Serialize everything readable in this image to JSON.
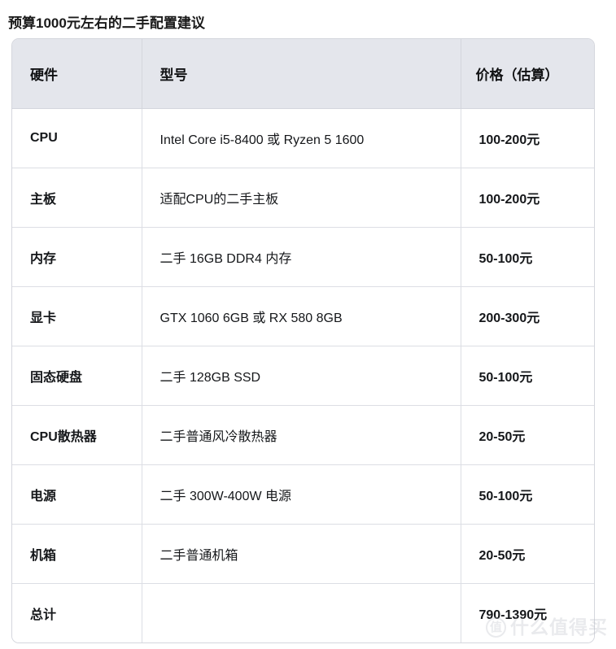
{
  "page": {
    "title": "预算1000元左右的二手配置建议",
    "background_color": "#ffffff",
    "text_color": "#1a1a1a"
  },
  "table": {
    "border_color": "#d4d6dd",
    "header_background": "#e4e6ec",
    "row_background": "#ffffff",
    "headers": {
      "hardware": "硬件",
      "model": "型号",
      "price": "价格（估算）"
    },
    "rows": [
      {
        "hardware": "CPU",
        "model": "Intel Core i5-8400 或 Ryzen 5 1600",
        "price": "100-200元"
      },
      {
        "hardware": "主板",
        "model": "适配CPU的二手主板",
        "price": "100-200元"
      },
      {
        "hardware": "内存",
        "model": "二手 16GB DDR4 内存",
        "price": "50-100元"
      },
      {
        "hardware": "显卡",
        "model": "GTX 1060 6GB 或 RX 580 8GB",
        "price": "200-300元"
      },
      {
        "hardware": "固态硬盘",
        "model": "二手 128GB SSD",
        "price": "50-100元"
      },
      {
        "hardware": "CPU散热器",
        "model": "二手普通风冷散热器",
        "price": "20-50元"
      },
      {
        "hardware": "电源",
        "model": "二手 300W-400W 电源",
        "price": "50-100元"
      },
      {
        "hardware": "机箱",
        "model": "二手普通机箱",
        "price": "20-50元"
      },
      {
        "hardware": "总计",
        "model": "",
        "price": "790-1390元"
      }
    ]
  },
  "watermark": {
    "badge": "值",
    "text": "什么值得买",
    "color": "#b9bcc4"
  }
}
